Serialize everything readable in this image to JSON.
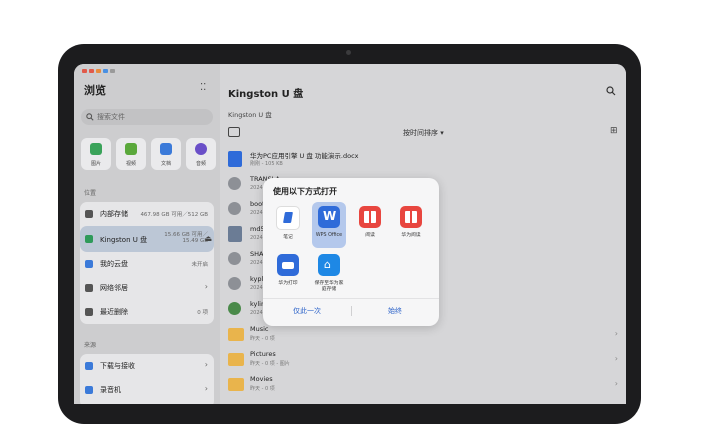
{
  "sidebar": {
    "title": "浏览",
    "search_placeholder": "搜索文件",
    "categories": [
      "图片",
      "视频",
      "文档",
      "音频"
    ],
    "locations_header": "位置",
    "locations": [
      {
        "label": "内部存储",
        "right": "467.98 GB 可用／512 GB"
      },
      {
        "label": "Kingston U 盘",
        "right1": "15.66 GB 可用／",
        "right2": "15.49 GB"
      },
      {
        "label": "我的云盘",
        "right": "未开启"
      },
      {
        "label": "网络邻居",
        "right": ""
      },
      {
        "label": "最近删除",
        "right": "0 项"
      }
    ],
    "sources_header": "来源",
    "sources": [
      {
        "label": "下载与接收"
      },
      {
        "label": "录音机"
      }
    ]
  },
  "main": {
    "title": "Kingston U 盘",
    "breadcrumb": "Kingston U 盘",
    "sort_label": "按时间排序 ▾",
    "files": [
      {
        "name": "华为PC应用引擎 U 盘 功能演示.docx",
        "meta": "刚刚 - 105 KB"
      },
      {
        "name": "TRANSLA…",
        "meta": "2024…"
      },
      {
        "name": "boot…",
        "meta": "2024…"
      },
      {
        "name": "md5…",
        "meta": "2024…"
      },
      {
        "name": "SHA…",
        "meta": "2024…"
      },
      {
        "name": "kyplk…",
        "meta": "2024…"
      },
      {
        "name": "kylin…",
        "meta": "2024…"
      },
      {
        "name": "Music",
        "meta": "昨天 - 0 项"
      },
      {
        "name": "Pictures",
        "meta": "昨天 - 0 项 - 图片"
      },
      {
        "name": "Movies",
        "meta": "昨天 - 0 项"
      }
    ]
  },
  "dialog": {
    "title": "使用以下方式打开",
    "apps": [
      {
        "label": "笔记",
        "color": "#ffffff"
      },
      {
        "label": "WPS Office",
        "color": "#2f6bd9"
      },
      {
        "label": "阅读",
        "color": "#e8463f"
      },
      {
        "label": "华为阅读",
        "color": "#e8463f"
      },
      {
        "label": "华为打印",
        "color": "#2f6bd9"
      },
      {
        "label": "保存至华为家庭存储",
        "color": "#1e88e5"
      }
    ],
    "once_label": "仅此一次",
    "always_label": "始终"
  },
  "colors": {
    "accent": "#2b62c9",
    "folder": "#e9b44c"
  }
}
